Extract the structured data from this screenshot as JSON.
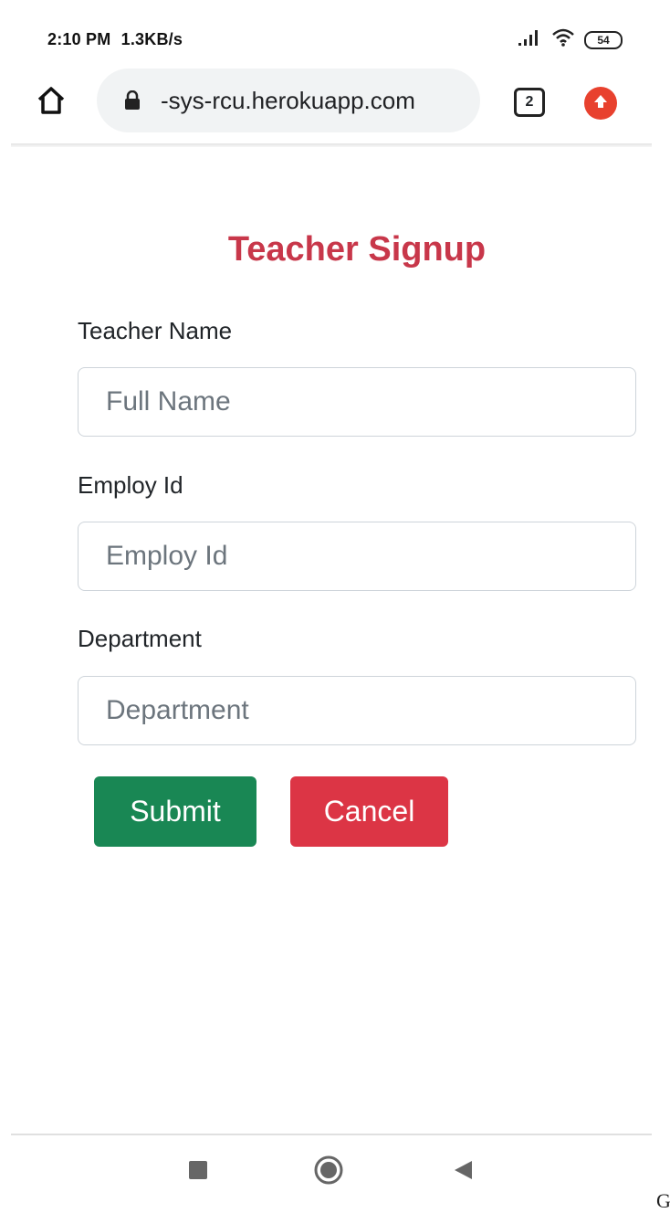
{
  "status_bar": {
    "time": "2:10 PM",
    "network_speed": "1.3KB/s",
    "battery": "54",
    "signal_icon": "signal-icon",
    "wifi_icon": "wifi-icon"
  },
  "browser": {
    "url": "-sys-rcu.herokuapp.com",
    "tab_count": "2",
    "home_icon": "home-icon",
    "lock_icon": "lock-icon",
    "update_icon": "update-arrow-icon",
    "update_color": "#e8412e"
  },
  "form": {
    "title": "Teacher Signup",
    "title_color": "#c8374a",
    "fields": [
      {
        "label": "Teacher Name",
        "placeholder": "Full Name",
        "value": ""
      },
      {
        "label": "Employ Id",
        "placeholder": "Employ Id",
        "value": ""
      },
      {
        "label": "Department",
        "placeholder": "Department",
        "value": ""
      }
    ],
    "submit_label": "Submit",
    "submit_color": "#198754",
    "cancel_label": "Cancel",
    "cancel_color": "#dc3545"
  },
  "nav_bar": {
    "recents_icon": "square-recents-icon",
    "home_icon": "circle-home-icon",
    "back_icon": "triangle-back-icon"
  },
  "corner_text": "G"
}
